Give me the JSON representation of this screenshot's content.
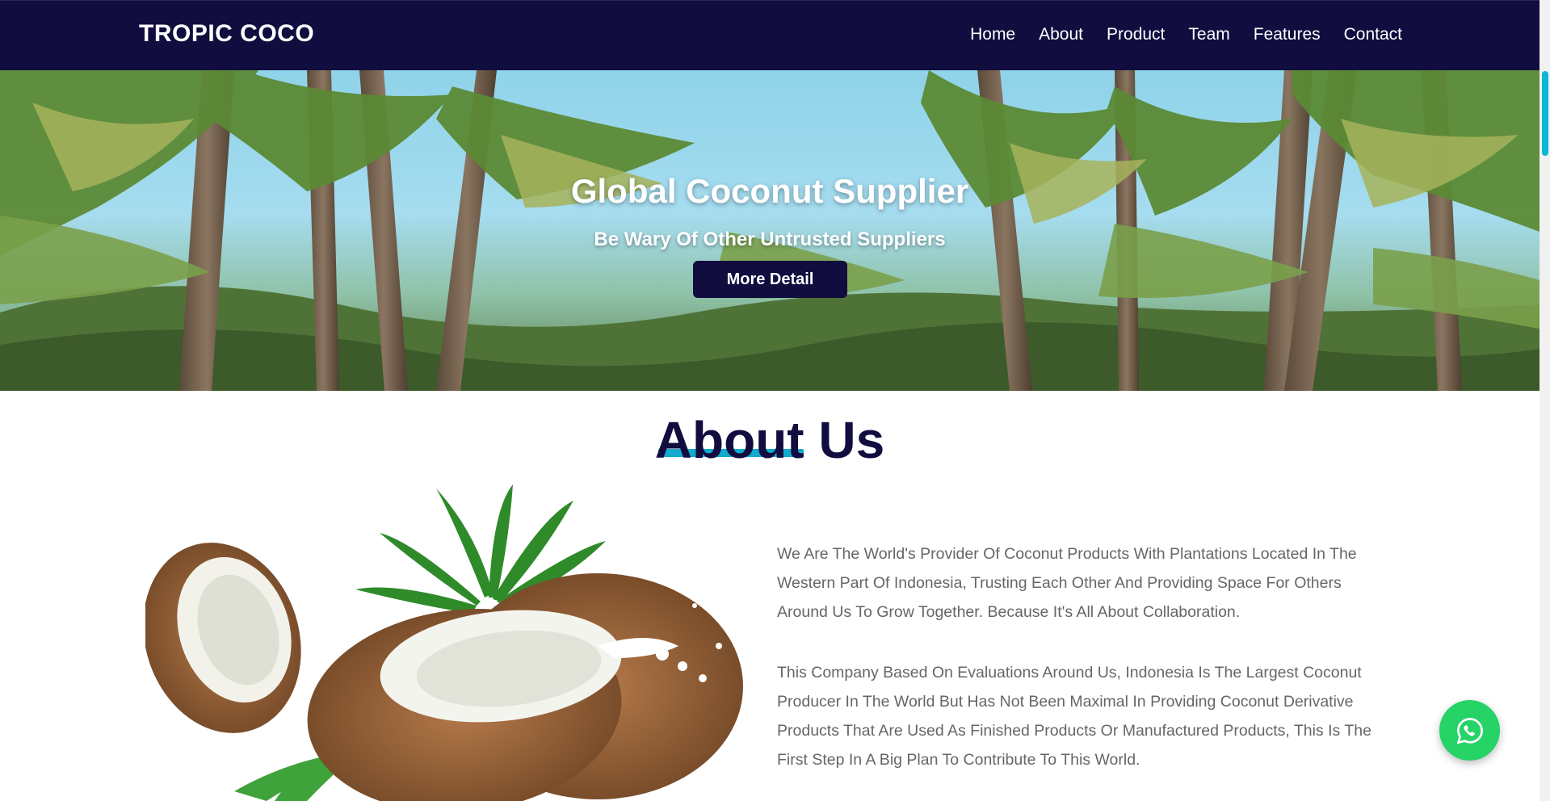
{
  "brand": "TROPIC COCO",
  "nav": {
    "items": [
      {
        "label": "Home"
      },
      {
        "label": "About"
      },
      {
        "label": "Product"
      },
      {
        "label": "Team"
      },
      {
        "label": "Features"
      },
      {
        "label": "Contact"
      }
    ]
  },
  "hero": {
    "title": "Global Coconut Supplier",
    "subtitle": "Be Wary Of Other Untrusted Suppliers",
    "button_label": "More Detail"
  },
  "about": {
    "title": "About Us",
    "paragraphs": [
      "We Are The World's Provider Of Coconut Products With Plantations Located In The Western Part Of Indonesia, Trusting Each Other And Providing Space For Others Around Us To Grow Together. Because It's All About Collaboration.",
      "This Company Based On Evaluations Around Us, Indonesia Is The Largest Coconut Producer In The World But Has Not Been Maximal In Providing Coconut Derivative Products That Are Used As Finished Products Or Manufactured Products, This Is The First Step In A Big Plan To Contribute To This World."
    ]
  },
  "icons": {
    "whatsapp": "whatsapp-icon"
  },
  "colors": {
    "navbar_bg": "#110d3f",
    "accent": "#12aacd",
    "whatsapp": "#25d366",
    "body_text": "#666666"
  }
}
